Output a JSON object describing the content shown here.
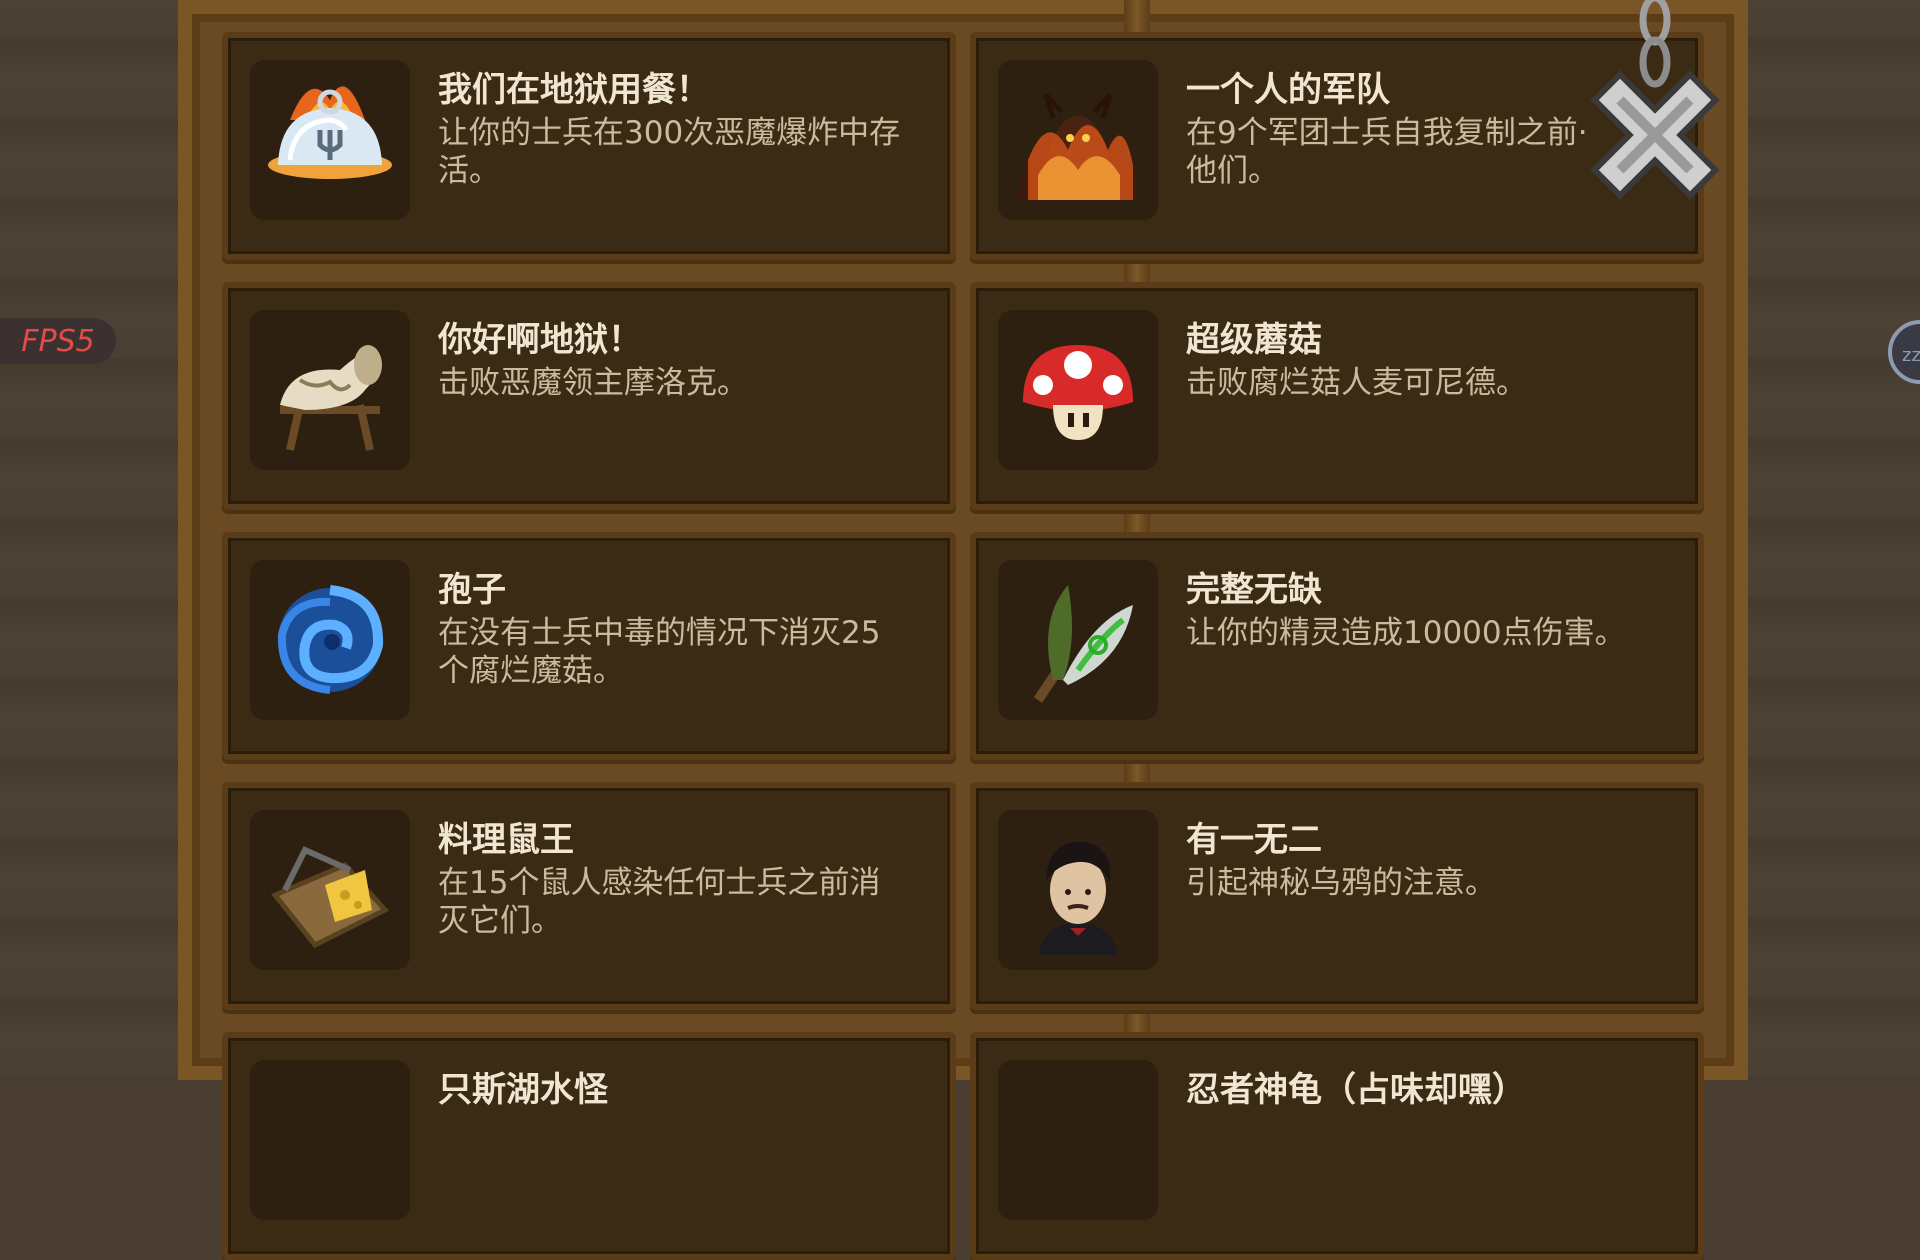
{
  "fps_label": "FPS5",
  "side_button_label": "zz",
  "achievements": [
    {
      "title": "我们在地狱用餐！",
      "desc": "让你的士兵在300次恶魔爆炸中存\n活。",
      "icon": "cloche-icon"
    },
    {
      "title": "一个人的军队",
      "desc": "在9个军团士兵自我复制之前·\n他们。",
      "icon": "demon-army-icon"
    },
    {
      "title": "你好啊地狱！",
      "desc": "击败恶魔领主摩洛克。",
      "icon": "horn-icon"
    },
    {
      "title": "超级蘑菇",
      "desc": "击败腐烂菇人麦可尼德。",
      "icon": "mushroom-icon"
    },
    {
      "title": "孢子",
      "desc": "在没有士兵中毒的情况下消灭25\n个腐烂魔菇。",
      "icon": "spore-swirl-icon"
    },
    {
      "title": "完整无缺",
      "desc": "让你的精灵造成10000点伤害。",
      "icon": "elf-leaf-blade-icon"
    },
    {
      "title": "料理鼠王",
      "desc": "在15个鼠人感染任何士兵之前消\n灭它们。",
      "icon": "mousetrap-icon"
    },
    {
      "title": "有一无二",
      "desc": "引起神秘乌鸦的注意。",
      "icon": "poet-portrait-icon"
    },
    {
      "title": "只斯湖水怪",
      "desc": "",
      "icon": "lake-monster-icon"
    },
    {
      "title": "忍者神龟（占味却嘿）",
      "desc": "",
      "icon": "ninja-turtle-icon"
    }
  ]
}
